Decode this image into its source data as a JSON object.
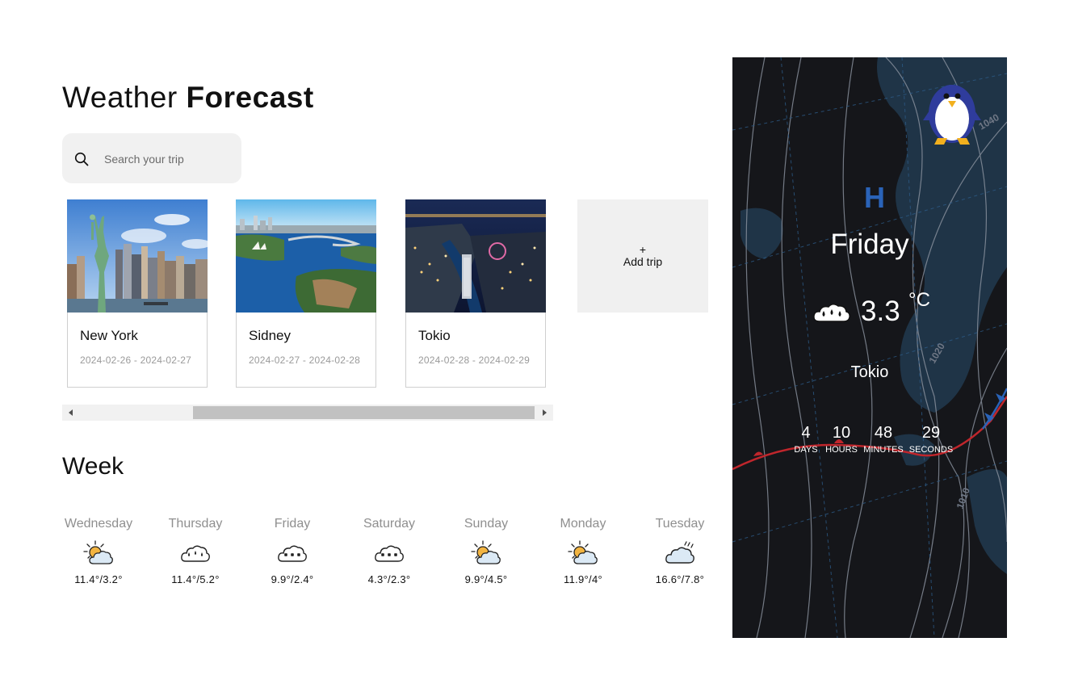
{
  "header": {
    "title_light": "Weather",
    "title_bold": "Forecast"
  },
  "search": {
    "placeholder": "Search your trip",
    "value": ""
  },
  "trips": [
    {
      "name": "New York",
      "dates": "2024-02-26 - 2024-02-27"
    },
    {
      "name": "Sidney",
      "dates": "2024-02-27 - 2024-02-28"
    },
    {
      "name": "Tokio",
      "dates": "2024-02-28 - 2024-02-29"
    }
  ],
  "add_trip": {
    "plus": "+",
    "label": "Add trip"
  },
  "week": {
    "title": "Week",
    "days": [
      {
        "name": "Wednesday",
        "icon": "partly-cloudy-icon",
        "temps": "11.4°/3.2°"
      },
      {
        "name": "Thursday",
        "icon": "rain-cloud-icon",
        "temps": "11.4°/5.2°"
      },
      {
        "name": "Friday",
        "icon": "snow-cloud-icon",
        "temps": "9.9°/2.4°"
      },
      {
        "name": "Saturday",
        "icon": "snow-cloud-icon",
        "temps": "4.3°/2.3°"
      },
      {
        "name": "Sunday",
        "icon": "partly-cloudy-icon",
        "temps": "9.9°/4.5°"
      },
      {
        "name": "Monday",
        "icon": "partly-cloudy-icon",
        "temps": "11.9°/4°"
      },
      {
        "name": "Tuesday",
        "icon": "drizzle-cloud-icon",
        "temps": "16.6°/7.8°"
      }
    ]
  },
  "today": {
    "pressure_letter": "H",
    "day": "Friday",
    "icon": "rain-cloud-icon",
    "temp": "3.3",
    "unit": "°C",
    "city": "Tokio",
    "isobar_labels": [
      "1040",
      "1020",
      "1010"
    ],
    "countdown": {
      "days": "4",
      "days_label": "DAYS",
      "hours": "10",
      "hours_label": "HOURS",
      "minutes": "48",
      "minutes_label": "MINUTES",
      "seconds": "29",
      "seconds_label": "SECONDS"
    }
  },
  "colors": {
    "panel_bg": "#15161a",
    "pressure_blue": "#2a63b8",
    "front_red": "#c0262c",
    "front_blue": "#2a63b8"
  }
}
